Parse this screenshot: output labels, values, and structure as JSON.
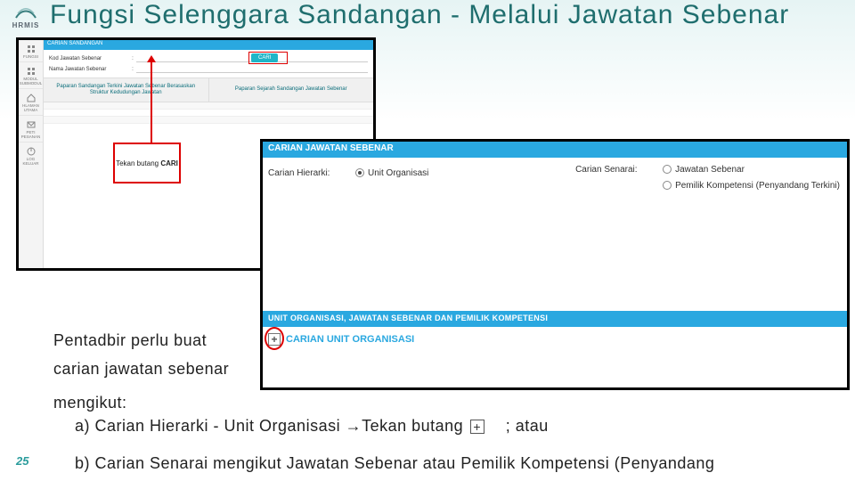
{
  "logo_text": "HRMIS",
  "title": "Fungsi Selenggara Sandangan - Melalui Jawatan Sebenar",
  "page_number": "25",
  "frame1": {
    "banner": "CARIAN SANDANGAN",
    "row1_label": "Kod Jawatan Sebenar",
    "row2_label": "Nama Jawatan Sebenar",
    "cari_label": "CARI",
    "tab1": "Paparan Sandangan Terkini Jawatan Sebenar Berasaskan Struktur Kedudungan Jawatan",
    "tab2": "Paparan Sejarah Sandangan Jawatan Sebenar",
    "callout": "Tekan butang CARI"
  },
  "frame2": {
    "banner1": "CARIAN JAWATAN SEBENAR",
    "left_label": "Carian Hierarki:",
    "left_opt": "Unit Organisasi",
    "right_label": "Carian Senarai:",
    "right_opt1": "Jawatan Sebenar",
    "right_opt2": "Pemilik Kompetensi (Penyandang Terkini)",
    "banner2": "UNIT ORGANISASI, JAWATAN SEBENAR DAN PEMILIK KOMPETENSI",
    "expand_label": "CARIAN UNIT ORGANISASI",
    "plus": "+"
  },
  "body": {
    "line1": "Pentadbir perlu buat",
    "line2": "carian jawatan sebenar",
    "line3": "mengikut:",
    "line4a": "a) Carian Hierarki - Unit Organisasi →Tekan butang",
    "line4b": ";  atau",
    "line5": "b) Carian Senarai mengikut Jawatan Sebenar atau Pemilik Kompetensi (Penyandang",
    "plus": "+"
  }
}
